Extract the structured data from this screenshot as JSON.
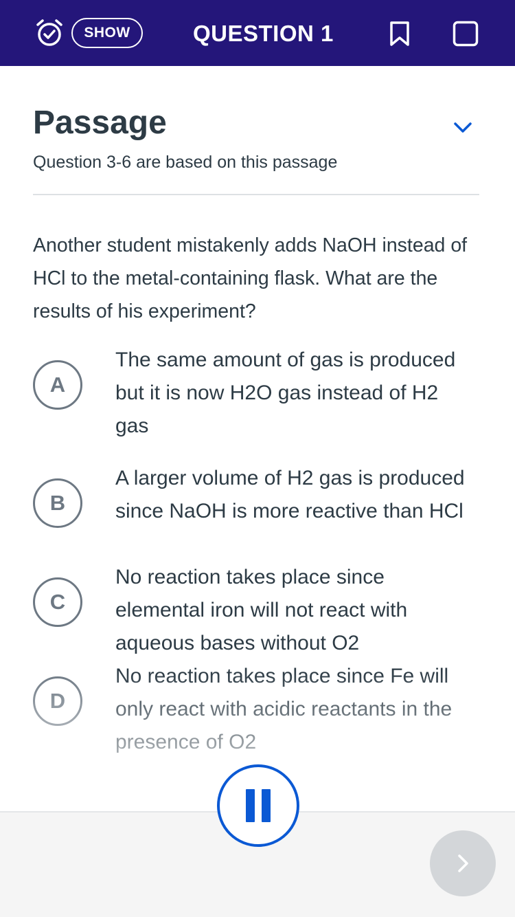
{
  "header": {
    "show_label": "SHOW",
    "title": "QUESTION 1",
    "icons": [
      "alarm-clock-icon",
      "bookmark-icon",
      "checkbox-icon"
    ],
    "background": "#24167a"
  },
  "passage": {
    "title": "Passage",
    "subtitle": "Question 3-6 are based on this passage"
  },
  "question": {
    "text": "Another student mistakenly adds NaOH instead of HCl to the metal-containing flask. What are the results of his experiment?"
  },
  "options": [
    {
      "letter": "A",
      "text": "The same amount of gas is produced but it is now H2O gas instead of H2 gas"
    },
    {
      "letter": "B",
      "text": "A larger volume of H2 gas is produced since NaOH is more reactive than HCl"
    },
    {
      "letter": "C",
      "text": "No reaction takes place since elemental iron will not react with aqueous bases without O2"
    },
    {
      "letter": "D",
      "text": "No reaction takes place since Fe will only react with acidic reactants in the presence of O2"
    }
  ],
  "controls": {
    "pause_icon": "pause-icon",
    "next_icon": "chevron-right-icon",
    "accent": "#0b59d4"
  }
}
